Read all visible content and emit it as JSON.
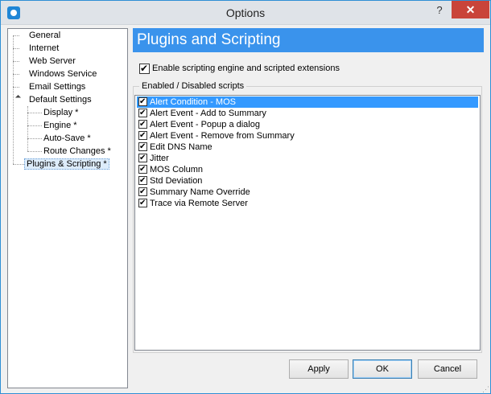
{
  "window": {
    "title": "Options",
    "help_glyph": "?",
    "close_glyph": "✕"
  },
  "tree": {
    "items": [
      {
        "label": "General"
      },
      {
        "label": "Internet"
      },
      {
        "label": "Web Server"
      },
      {
        "label": "Windows Service"
      },
      {
        "label": "Email Settings"
      },
      {
        "label": "Default Settings"
      },
      {
        "label": "Display *"
      },
      {
        "label": "Engine *"
      },
      {
        "label": "Auto-Save *"
      },
      {
        "label": "Route Changes *"
      },
      {
        "label": "Plugins & Scripting *"
      }
    ],
    "selected": "Plugins & Scripting *"
  },
  "panel": {
    "header": "Plugins and Scripting",
    "enable_label": "Enable scripting engine and scripted extensions",
    "enable_checked": true,
    "group_label": "Enabled / Disabled scripts",
    "scripts": [
      {
        "label": "Alert Condition - MOS",
        "checked": true
      },
      {
        "label": "Alert Event - Add to Summary",
        "checked": true
      },
      {
        "label": "Alert Event - Popup a dialog",
        "checked": true
      },
      {
        "label": "Alert Event - Remove from Summary",
        "checked": true
      },
      {
        "label": "Edit DNS Name",
        "checked": true
      },
      {
        "label": "Jitter",
        "checked": true
      },
      {
        "label": "MOS Column",
        "checked": true
      },
      {
        "label": "Std Deviation",
        "checked": true
      },
      {
        "label": "Summary Name Override",
        "checked": true
      },
      {
        "label": "Trace via Remote Server",
        "checked": true
      }
    ],
    "selected_script": "Alert Condition - MOS"
  },
  "buttons": {
    "apply": "Apply",
    "ok": "OK",
    "cancel": "Cancel"
  },
  "colors": {
    "accent": "#3a93ec",
    "selection": "#3399ff",
    "close": "#c9443a"
  }
}
